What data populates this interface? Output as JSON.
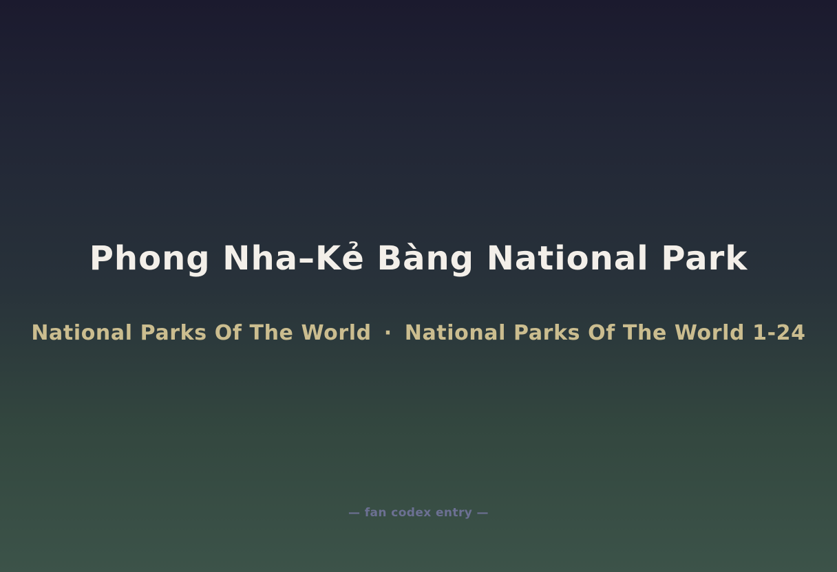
{
  "title": "Phong Nha–Kẻ Bàng National Park",
  "subtitle": {
    "left": "National Parks Of The World",
    "separator": "·",
    "right": "National Parks Of The World 1-24"
  },
  "footer": "— fan codex entry —",
  "colors": {
    "title": "#f3efe9",
    "subtitle": "#cbbd8f",
    "footer": "#6c7093",
    "background_top": "#1b1a2e",
    "background_bottom": "#3c5349"
  }
}
